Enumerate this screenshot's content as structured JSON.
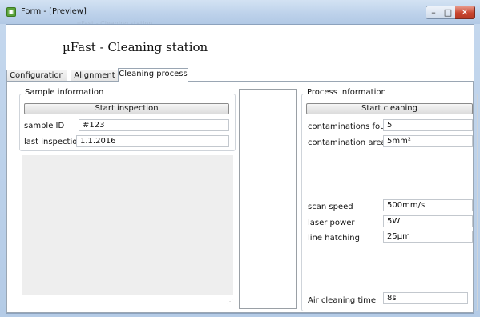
{
  "window": {
    "title": "Form - [Preview]",
    "ghost_title": "µFast - Cleaning station",
    "app_icon_glyph": "▣",
    "controls": {
      "minimize": "–",
      "maximize": "□",
      "close": "✕"
    }
  },
  "app_title": "µFast - Cleaning station",
  "tabs": [
    {
      "label": "Configuration",
      "active": false
    },
    {
      "label": "Alignment",
      "active": false
    },
    {
      "label": "Cleaning process",
      "active": true
    }
  ],
  "sample_info": {
    "title": "Sample information",
    "start_button": "Start inspection",
    "fields": [
      {
        "label": "sample ID",
        "value": "#123"
      },
      {
        "label": "last inspection",
        "value": "1.1.2016"
      }
    ]
  },
  "process_info": {
    "title": "Process information",
    "start_button": "Start cleaning",
    "contaminations_found": {
      "label": "contaminations found",
      "value": "5"
    },
    "contamination_area": {
      "label": "contamination area",
      "value": "5mm²"
    },
    "scan_speed": {
      "label": "scan speed",
      "value": "500mm/s"
    },
    "laser_power": {
      "label": "laser power",
      "value": "5W"
    },
    "line_hatching": {
      "label": "line hatching",
      "value": "25µm"
    },
    "air_cleaning_time": {
      "label": "Air cleaning time",
      "value": "8s"
    }
  },
  "icons": {
    "app": "form-app-icon",
    "resize_grip": "resize-grip-icon"
  }
}
